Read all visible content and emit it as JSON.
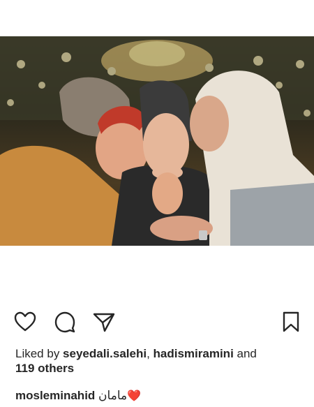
{
  "post": {
    "image_alt": "Three women embracing; two kiss the cheeks of an elderly woman in a headscarf in front of a chandelier",
    "liked_by_prefix": "Liked by ",
    "liked_user_1": "seyedali.salehi",
    "liked_sep": ", ",
    "liked_user_2": "hadismiramini",
    "liked_and": " and",
    "liked_others": "119 others",
    "caption_username": "mosleminahid",
    "caption_text": "مامان",
    "caption_emoji": "❤️"
  },
  "icons": {
    "like": "heart-outline-icon",
    "comment": "speech-bubble-icon",
    "share": "paper-plane-icon",
    "save": "bookmark-icon"
  },
  "colors": {
    "text": "#262626",
    "emoji_red": "#e0245e"
  }
}
